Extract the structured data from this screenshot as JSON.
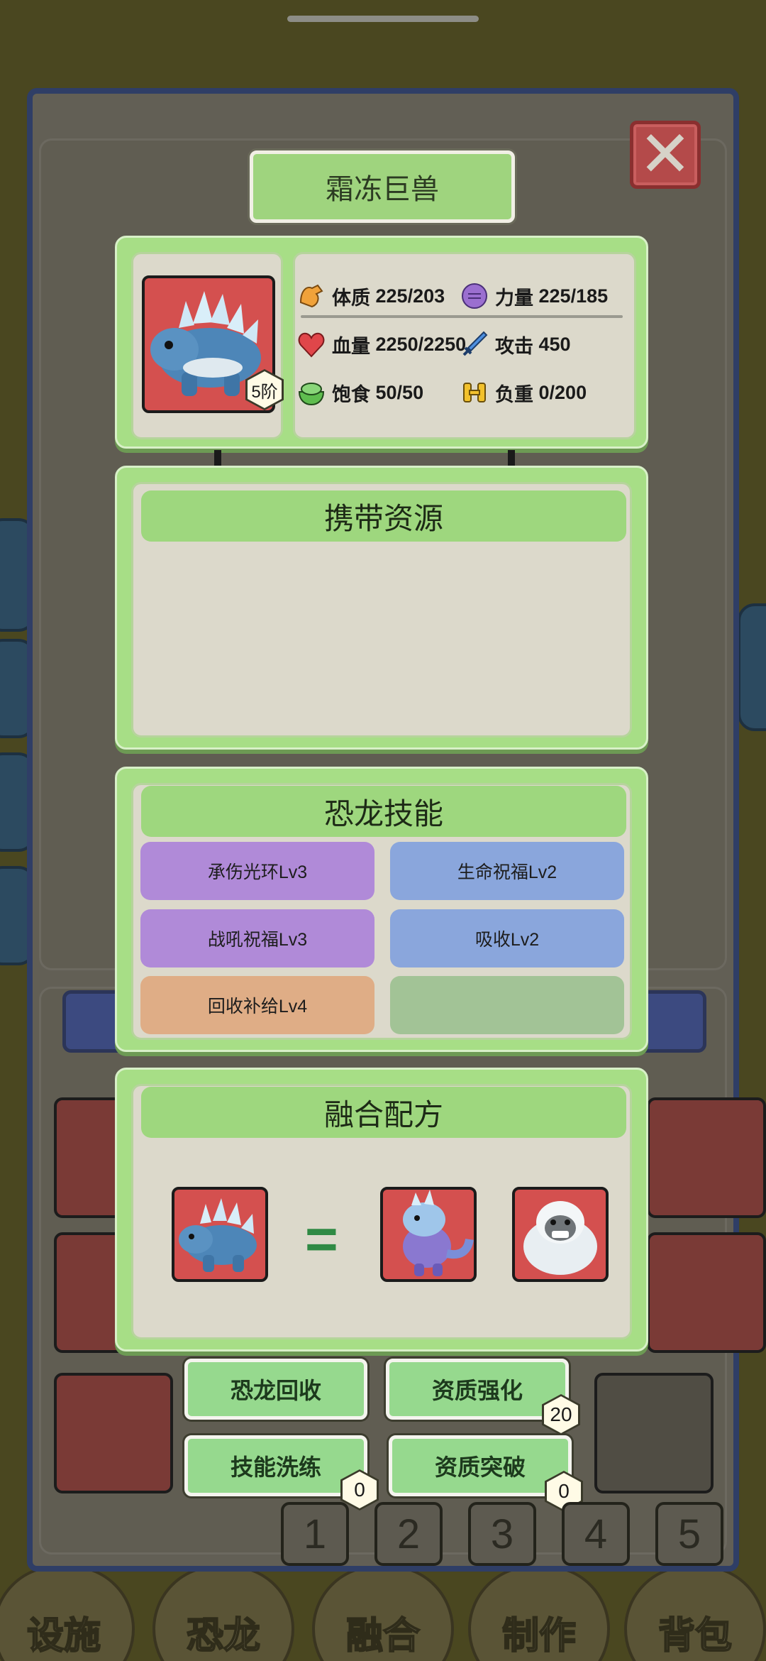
{
  "title": "霜冻巨兽",
  "close_label": "✕",
  "dino": {
    "rank_label": "5阶"
  },
  "stats": {
    "constitution": {
      "label": "体质",
      "value": "225/203"
    },
    "strength": {
      "label": "力量",
      "value": "225/185"
    },
    "hp": {
      "label": "血量",
      "value": "2250/2250"
    },
    "attack": {
      "label": "攻击",
      "value": "450"
    },
    "satiety": {
      "label": "饱食",
      "value": "50/50"
    },
    "load": {
      "label": "负重",
      "value": "0/200"
    }
  },
  "resources": {
    "header": "携带资源"
  },
  "skills": {
    "header": "恐龙技能",
    "items": [
      {
        "label": "承伤光环Lv3",
        "color": "#b08ad8"
      },
      {
        "label": "生命祝福Lv2",
        "color": "#8aa6dc"
      },
      {
        "label": "战吼祝福Lv3",
        "color": "#b08ad8"
      },
      {
        "label": "吸收Lv2",
        "color": "#8aa6dc"
      },
      {
        "label": "回收补给Lv4",
        "color": "#dfad86"
      },
      {
        "label": "",
        "color": "#a2c396"
      }
    ]
  },
  "fusion": {
    "header": "融合配方",
    "equals": "="
  },
  "actions": {
    "recycle": "恐龙回收",
    "enhance": "资质强化",
    "enhance_count": "20",
    "reroll": "技能洗练",
    "reroll_count": "0",
    "breakthrough": "资质突破",
    "breakthrough_count": "0"
  },
  "slots": [
    "1",
    "2",
    "3",
    "4",
    "5"
  ],
  "bottom_nav": [
    "设施",
    "恐龙",
    "融合",
    "制作",
    "背包"
  ],
  "colors": {
    "panel_green": "#a7de86",
    "header_green": "#9ed77e",
    "dialog_border": "#2f3e66",
    "close_red": "#b44a4a"
  }
}
